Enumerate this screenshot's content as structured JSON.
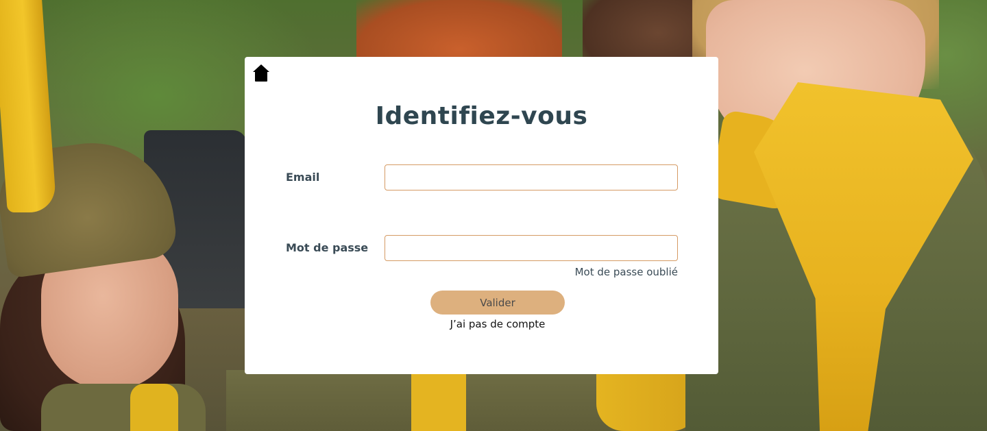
{
  "login": {
    "title": "Identifiez-vous",
    "email_label": "Email",
    "email_value": "",
    "email_placeholder": "",
    "password_label": "Mot de passe",
    "password_value": "",
    "password_placeholder": "",
    "forgot_password_link": "Mot de passe oublié",
    "submit_label": "Valider",
    "no_account_link": "J’ai pas de compte"
  },
  "icons": {
    "home": "home-icon"
  },
  "colors": {
    "title_text": "#2f4650",
    "input_border": "#d59a63",
    "button_bg": "#ddb07e",
    "card_bg": "#ffffff"
  }
}
